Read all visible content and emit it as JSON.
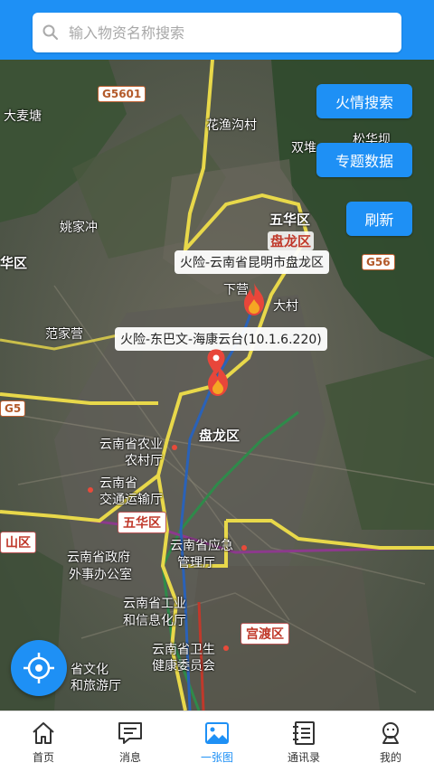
{
  "search": {
    "placeholder": "输入物资名称搜索"
  },
  "map_buttons": {
    "fire_search": "火情搜索",
    "topic_data": "专题数据",
    "refresh": "刷新"
  },
  "markers": [
    {
      "label": "火险-云南省昆明市盘龙区"
    },
    {
      "label": "火险-东巴文-海康云台(10.1.6.220)"
    }
  ],
  "map_labels": {
    "dmt": "大麦塘",
    "hyg": "花渔沟村",
    "sd": "双堆",
    "sbb": "松华坝",
    "yjc": "姚家冲",
    "whq1": "五华区",
    "plq1": "盘龙区",
    "ggq": "华区",
    "fjy": "范家营",
    "xia": "下营",
    "ddc": "大村",
    "plq2": "盘龙区",
    "ynnong": "云南省农业",
    "ncting": "农村厅",
    "yn2": "云南省",
    "jtyst": "交通运输厅",
    "whq2": "五华区",
    "ynzf": "云南省政府",
    "wsbgs": "外事办公室",
    "ynyj": "云南省应急",
    "gly": "管理厅",
    "ynsgy": "云南省工业",
    "xxht": "和信息化厅",
    "gdq": "宫渡区",
    "ynwsjk": "云南省卫生",
    "jkwyh": "健康委员会",
    "whly": "省文化",
    "lyt": "和旅游厅",
    "shan": "山区",
    "kq": "官渡",
    "g5": "G5",
    "g5601": "G5601",
    "g56": "G56"
  },
  "nav": [
    {
      "label": "首页",
      "icon": "home-icon"
    },
    {
      "label": "消息",
      "icon": "message-icon"
    },
    {
      "label": "一张图",
      "icon": "map-image-icon"
    },
    {
      "label": "通讯录",
      "icon": "contacts-icon"
    },
    {
      "label": "我的",
      "icon": "profile-icon"
    }
  ],
  "colors": {
    "accent": "#1e90f5",
    "fire": "#e8463a"
  }
}
